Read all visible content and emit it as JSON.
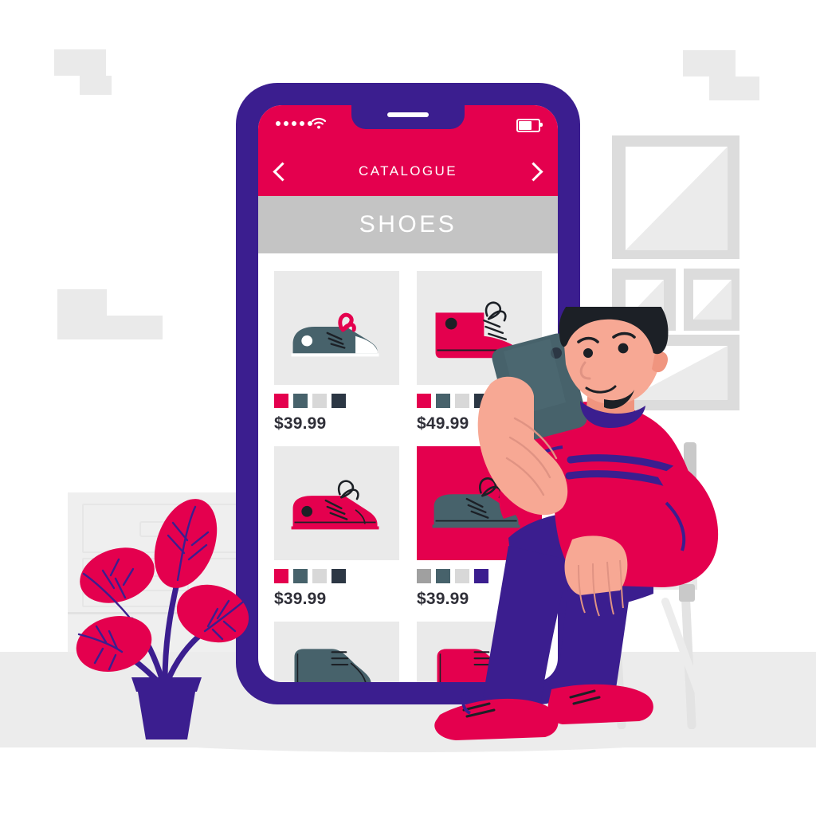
{
  "scene": {
    "title": "Online shoe shopping catalogue illustration",
    "colors": {
      "crimson": "#e4004e",
      "purple": "#3b1e8f",
      "slate": "#47626b",
      "navy": "#2c3744",
      "light_grey": "#d8d8d8",
      "banner_grey": "#c4c4c4",
      "skin": "#f7a894",
      "hair": "#1c2026",
      "chair": "#e9e9e9",
      "wall": "#ffffff"
    }
  },
  "phone": {
    "status_bar": {
      "signal_dots": 5,
      "wifi_icon": "wifi-icon",
      "battery_icon": "battery-icon",
      "battery_level_pct": 62
    },
    "nav": {
      "back_icon": "chevron-left-icon",
      "title": "CATALOGUE",
      "forward_icon": "chevron-right-icon"
    },
    "category_banner": {
      "label": "SHOES"
    },
    "products": [
      {
        "name": "sneaker-low-slate",
        "shoe_style": "low-top-sneaker",
        "shoe_color": "#47626b",
        "thumb_bg": "#eaeaea",
        "price": "$39.99",
        "swatches": [
          "#e4004e",
          "#47626b",
          "#d8d8d8",
          "#2c3744"
        ]
      },
      {
        "name": "sneaker-high-crimson",
        "shoe_style": "high-top-sneaker",
        "shoe_color": "#e4004e",
        "thumb_bg": "#eaeaea",
        "price": "$49.99",
        "swatches": [
          "#e4004e",
          "#47626b",
          "#d8d8d8",
          "#2c3744"
        ]
      },
      {
        "name": "sneaker-low-crimson",
        "shoe_style": "low-top-sneaker",
        "shoe_color": "#e4004e",
        "thumb_bg": "#eaeaea",
        "price": "$39.99",
        "swatches": [
          "#e4004e",
          "#47626b",
          "#d8d8d8",
          "#2c3744"
        ]
      },
      {
        "name": "sneaker-low-slate-featured",
        "shoe_style": "low-top-sneaker",
        "shoe_color": "#47626b",
        "thumb_bg": "#e4004e",
        "price": "$39.99",
        "swatches": [
          "#a0a0a0",
          "#47626b",
          "#d8d8d8",
          "#3b1e8f"
        ]
      },
      {
        "name": "boot-slate",
        "shoe_style": "ankle-boot",
        "shoe_color": "#47626b",
        "thumb_bg": "#eaeaea",
        "price": "",
        "swatches": []
      },
      {
        "name": "boot-crimson",
        "shoe_style": "ankle-boot",
        "shoe_color": "#e4004e",
        "thumb_bg": "#eaeaea",
        "price": "",
        "swatches": []
      }
    ]
  },
  "person": {
    "description": "seated man holding a smartphone",
    "hair_color": "#1c2026",
    "skin_color": "#f7a894",
    "sweater_color": "#e4004e",
    "sweater_stripe_color": "#3b1e8f",
    "pants_color": "#3b1e8f",
    "shoes_color": "#e4004e",
    "held_phone_color": "#47626b"
  },
  "furniture": {
    "chair": "white-chair",
    "cabinet": "filing-cabinet",
    "plant": {
      "name": "potted-plant",
      "leaf_color": "#e4004e",
      "vein_color": "#3b1e8f",
      "pot_color": "#3b1e8f",
      "leaf_count": 4
    }
  },
  "wall_art": {
    "frames": [
      {
        "name": "frame-large"
      },
      {
        "name": "frame-small-left"
      },
      {
        "name": "frame-small-right"
      },
      {
        "name": "frame-wide-bottom"
      }
    ]
  },
  "bg_blocks": [
    {
      "name": "bg-block-top-left-a"
    },
    {
      "name": "bg-block-top-left-b"
    },
    {
      "name": "bg-block-mid-left-a"
    },
    {
      "name": "bg-block-mid-left-b"
    },
    {
      "name": "bg-block-top-right-a"
    },
    {
      "name": "bg-block-top-right-b"
    }
  ]
}
